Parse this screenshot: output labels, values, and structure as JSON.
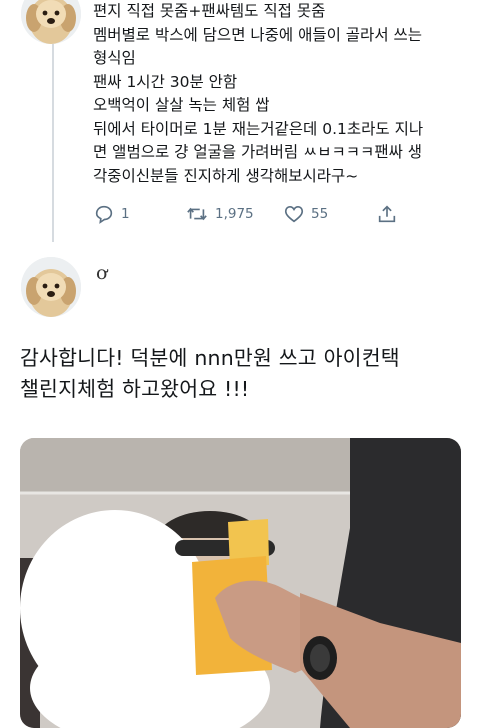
{
  "tweet1": {
    "lines": [
      "편지 직접 못줌+팬싸템도 직접 못줌",
      "멤버별로 박스에 담으면 나중에 애들이 골라서 쓰는",
      "형식임",
      "팬싸 1시간 30분 안함",
      "오백억이 살살 녹는 체험 쌉",
      "뒤에서 타이머로 1분 재는거같은데 0.1초라도 지나",
      "면 앨범으로 걍 얼굴을 가려버림 ㅆㅂㅋㅋㅋ팬싸 생",
      "각중이신분들 진지하게 생각해보시라구~"
    ],
    "replies": "1",
    "retweets": "1,975",
    "likes": "55"
  },
  "tweet2": {
    "handle": "ơ",
    "lines": [
      "감사합니다! 덕분에 nnn만원 쓰고 아이컨택",
      "챌린지체험 하고왔어요 !!!"
    ]
  }
}
